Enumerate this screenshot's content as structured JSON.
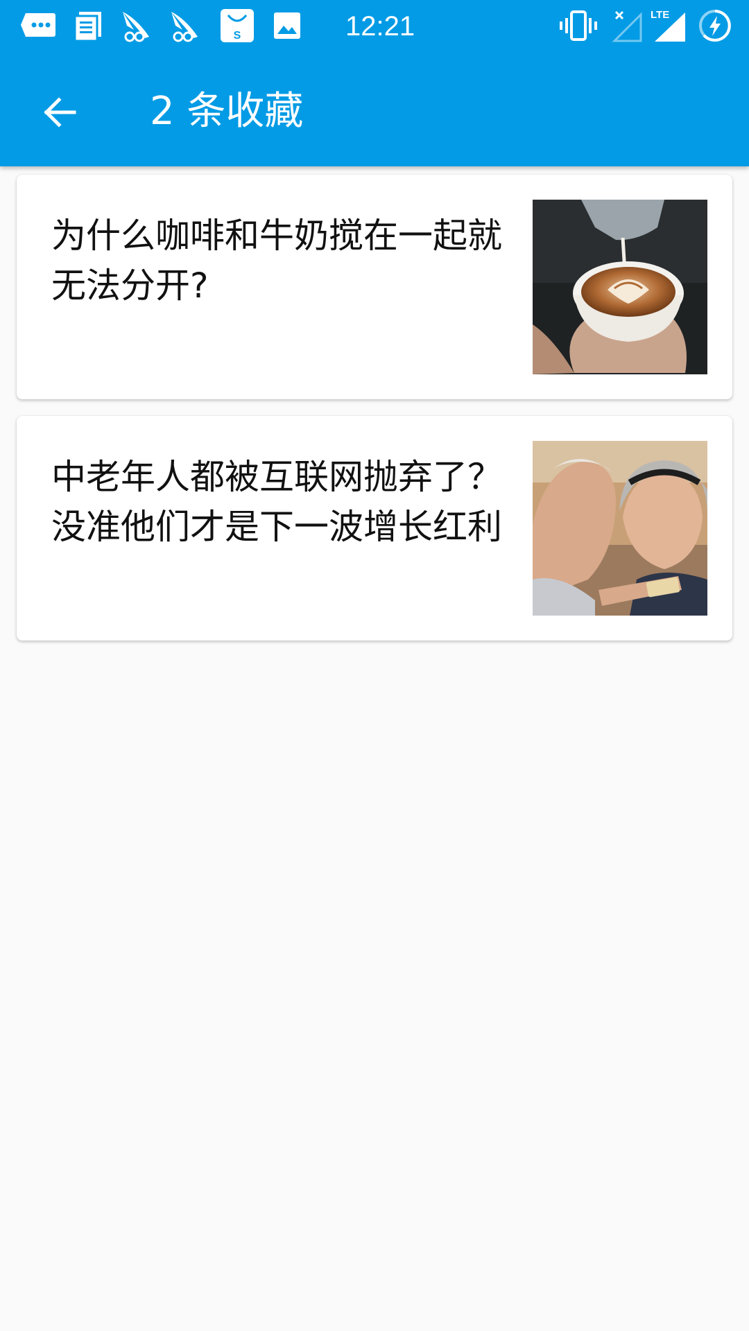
{
  "status_bar": {
    "time": "12:21",
    "left_icons": [
      "chat-notification-icon",
      "news-notification-icon",
      "app-notification-icon",
      "app-notification-icon",
      "store-notification-icon",
      "image-notification-icon"
    ],
    "right_icons": [
      "vibrate-icon",
      "no-signal-icon",
      "lte-signal-icon",
      "battery-charging-icon"
    ],
    "network_label": "LTE"
  },
  "toolbar": {
    "back_icon": "arrow-back-icon",
    "title": "2 条收藏"
  },
  "favorites": [
    {
      "title": "为什么咖啡和牛奶搅在一起就无法分开?",
      "thumbnail": "latte-art-photo"
    },
    {
      "title": "中老年人都被互联网抛弃了？没准他们才是下一波增长红利",
      "thumbnail": "elderly-couple-phone-photo"
    }
  ],
  "colors": {
    "primary": "#039be5",
    "background": "#fafafa",
    "card": "#ffffff",
    "text": "#111111"
  }
}
